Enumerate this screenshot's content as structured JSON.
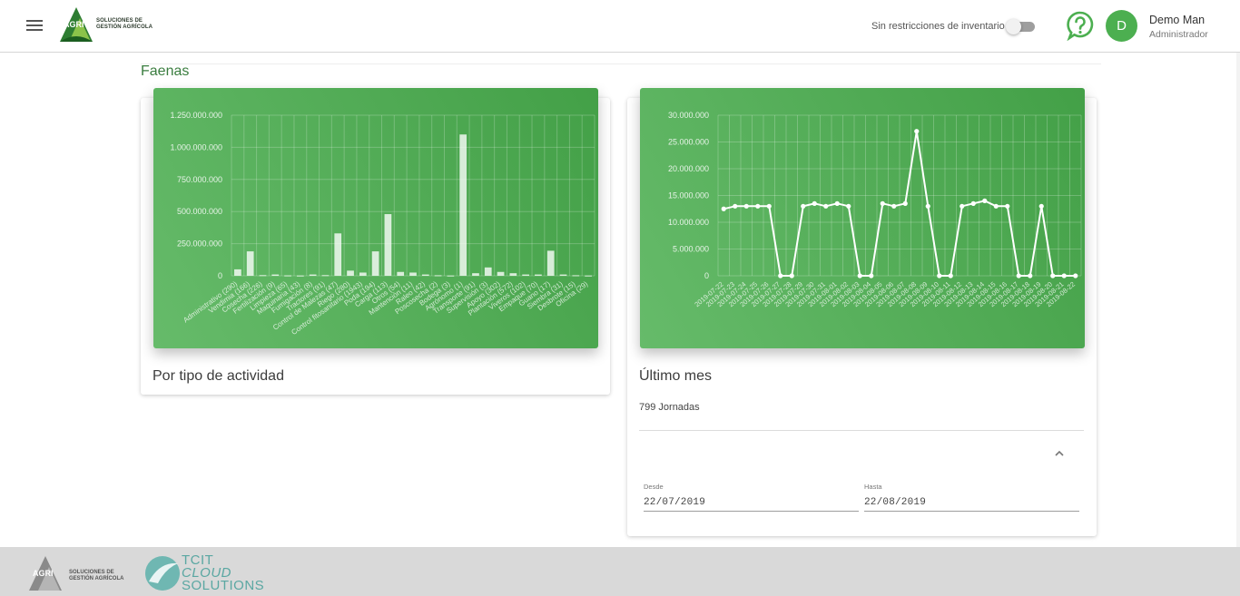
{
  "header": {
    "logo_word": "AGRI",
    "logo_text_line1": "SOLUCIONES DE",
    "logo_text_line2": "GESTIÓN AGRÍCOLA",
    "inventory_label": "Sin restricciones de inventario",
    "inventory_toggle_on": false,
    "avatar_letter": "D",
    "user_name": "Demo Man",
    "user_role": "Administrador"
  },
  "section": {
    "title": "Faenas"
  },
  "card_activity": {
    "title": "Por tipo de actividad"
  },
  "card_month": {
    "title": "Último mes",
    "jornadas": "799 Jornadas",
    "desde_label": "Desde",
    "desde_value": "22/07/2019",
    "hasta_label": "Hasta",
    "hasta_value": "22/08/2019"
  },
  "chart_data": [
    {
      "type": "bar",
      "title": "Por tipo de actividad",
      "ylim": [
        0,
        1250000000
      ],
      "yticks": [
        "0",
        "250.000.000",
        "500.000.000",
        "750.000.000",
        "1.000.000.000",
        "1.250.000.000"
      ],
      "ytick_values": [
        0,
        250000000,
        500000000,
        750000000,
        1000000000,
        1250000000
      ],
      "categories": [
        "Administrativo (290)",
        "Vendimia (166)",
        "Cosecha (226)",
        "Fertilización (9)",
        "Limpieza (65)",
        "Maquinaria (43)",
        "Fumigación (8)",
        "Tractores (91)",
        "Control de Malezas (47)",
        "Riego (280)",
        "Control fitosanitario (1943)",
        "Poda (194)",
        "Carga (113)",
        "Otros (54)",
        "Mantención (11)",
        "Raleo (42)",
        "Poscosecha (2)",
        "Bodega (3)",
        "Agrónomo (1)",
        "Transporte (91)",
        "Supervisión (3)",
        "Apoyo (302)",
        "Plantación (572)",
        "Viveros (102)",
        "Empaque (70)",
        "Guano (17)",
        "Siembra (31)",
        "Desbrote (15)",
        "Oficina (29)"
      ],
      "values": [
        50000000,
        190000000,
        5000000,
        10000000,
        3000000,
        2000000,
        10000000,
        5000000,
        330000000,
        40000000,
        25000000,
        190000000,
        480000000,
        30000000,
        25000000,
        10000000,
        4000000,
        2000000,
        1100000000,
        20000000,
        65000000,
        30000000,
        20000000,
        10000000,
        10000000,
        195000000,
        10000000,
        4000000,
        2000000
      ]
    },
    {
      "type": "line",
      "title": "Último mes",
      "ylim": [
        0,
        30000000
      ],
      "yticks": [
        "0",
        "5.000.000",
        "10.000.000",
        "15.000.000",
        "20.000.000",
        "25.000.000",
        "30.000.000"
      ],
      "ytick_values": [
        0,
        5000000,
        10000000,
        15000000,
        20000000,
        25000000,
        30000000
      ],
      "x": [
        "2019-07-22",
        "2019-07-23",
        "2019-07-24",
        "2019-07-25",
        "2019-07-26",
        "2019-07-27",
        "2019-07-28",
        "2019-07-29",
        "2019-07-30",
        "2019-07-31",
        "2019-08-01",
        "2019-08-02",
        "2019-08-03",
        "2019-08-04",
        "2019-08-05",
        "2019-08-06",
        "2019-08-07",
        "2019-08-08",
        "2019-08-09",
        "2019-08-10",
        "2019-08-11",
        "2019-08-12",
        "2019-08-13",
        "2019-08-14",
        "2019-08-15",
        "2019-08-16",
        "2019-08-17",
        "2019-08-18",
        "2019-08-19",
        "2019-08-20",
        "2019-08-21",
        "2019-08-22"
      ],
      "values": [
        12500000,
        13000000,
        13000000,
        13000000,
        13000000,
        0,
        0,
        13000000,
        13500000,
        13000000,
        13500000,
        13000000,
        0,
        0,
        13500000,
        13000000,
        13500000,
        27000000,
        13000000,
        0,
        0,
        13000000,
        13500000,
        14000000,
        13000000,
        13000000,
        0,
        0,
        13000000,
        0,
        0,
        0
      ]
    }
  ],
  "footer": {
    "logo_word": "AGRI",
    "logo_text_line1": "SOLUCIONES DE",
    "logo_text_line2": "GESTIÓN AGRÍCOLA",
    "partner_line1": "TCIT",
    "partner_line2": "CLOUD",
    "partner_line3": "SOLUTIONS"
  },
  "colors": {
    "accent": "#4caf50",
    "chart_bg_start": "#66bb6a",
    "chart_bg_end": "#43a047",
    "partner": "#5aa7a2"
  }
}
